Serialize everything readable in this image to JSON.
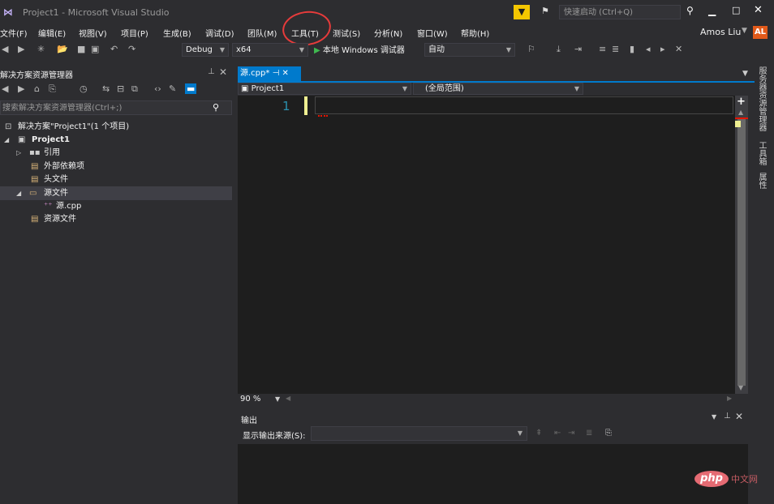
{
  "window": {
    "title": "Project1 - Microsoft Visual Studio",
    "logo_icon": "vs-logo-icon",
    "quick_launch_placeholder": "快速启动 (Ctrl+Q)",
    "min_glyph": "▁",
    "max_glyph": "□",
    "close_glyph": "✕"
  },
  "menu": {
    "items": [
      "文件(F)",
      "编辑(E)",
      "视图(V)",
      "项目(P)",
      "生成(B)",
      "调试(D)",
      "团队(M)",
      "工具(T)",
      "测试(S)",
      "分析(N)",
      "窗口(W)",
      "帮助(H)"
    ],
    "user": "Amos Liu",
    "avatar": "AL",
    "highlighted": "工具(T)"
  },
  "toolbar": {
    "config": "Debug",
    "platform": "x64",
    "run_label": "本地 Windows 调试器",
    "run_mode": "自动"
  },
  "solution_explorer": {
    "title": "解决方案资源管理器",
    "search_placeholder": "搜索解决方案资源管理器(Ctrl+;)",
    "tree": [
      {
        "label": "解决方案\"Project1\"(1 个项目)",
        "icon": "solution-icon"
      },
      {
        "label": "Project1",
        "icon": "project-icon"
      },
      {
        "label": "引用",
        "icon": "references-icon"
      },
      {
        "label": "外部依赖项",
        "icon": "external-deps-icon"
      },
      {
        "label": "头文件",
        "icon": "header-folder-icon"
      },
      {
        "label": "源文件",
        "icon": "source-folder-icon"
      },
      {
        "label": "源.cpp",
        "icon": "cpp-file-icon"
      },
      {
        "label": "资源文件",
        "icon": "resource-folder-icon"
      }
    ]
  },
  "editor": {
    "tab_label": "源.cpp*",
    "nav_scope": "Project1",
    "nav_member": "(全局范围)",
    "line_number": "1",
    "zoom": "90 %"
  },
  "output": {
    "title": "输出",
    "source_label": "显示输出来源(S):",
    "source_value": ""
  },
  "dock_tabs": [
    "服务器资源管理器",
    "工具箱",
    "属性"
  ],
  "watermark": {
    "badge": "php",
    "suffix": "中文网"
  },
  "colors": {
    "accent": "#007acc",
    "background": "#2d2d30",
    "editor_bg": "#1e1e1e",
    "annotation": "#e63b3b",
    "avatar_bg": "#e25a1a",
    "filter_icon_bg": "#f5c700"
  }
}
